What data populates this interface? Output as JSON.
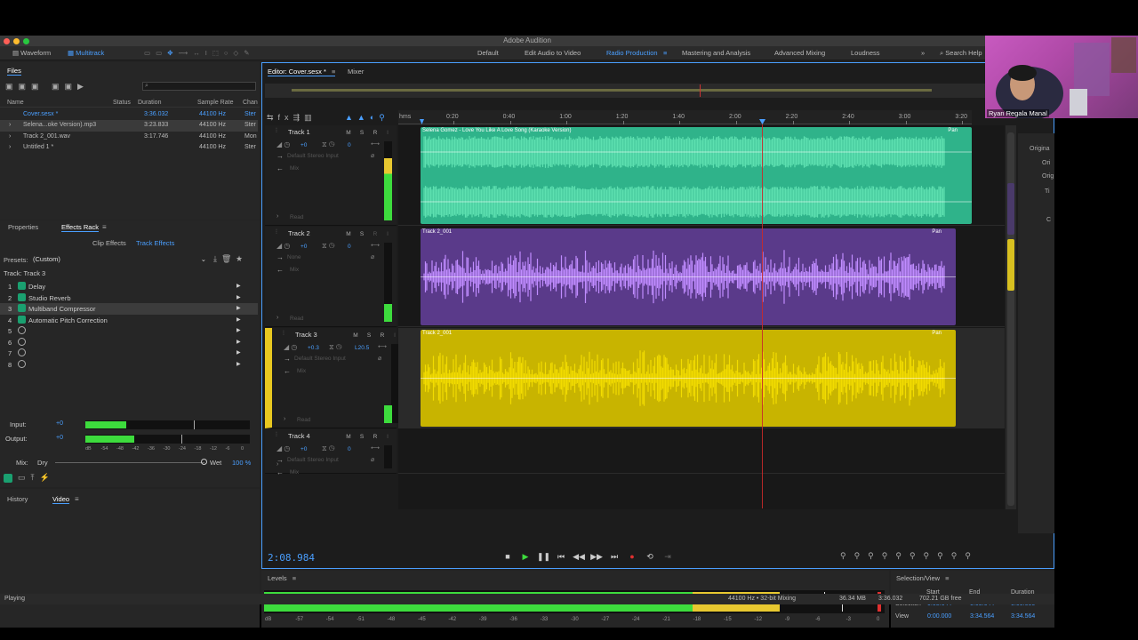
{
  "app": {
    "title": "Adobe Audition"
  },
  "toolbar": {
    "waveform": "Waveform",
    "multitrack": "Multitrack",
    "workspaces": [
      "Default",
      "Edit Audio to Video",
      "Radio Production",
      "Mastering and Analysis",
      "Advanced Mixing",
      "Loudness"
    ],
    "active_workspace": "Radio Production",
    "search_placeholder": "Search Help"
  },
  "files_panel": {
    "title": "Files",
    "columns": [
      "Name",
      "Status",
      "Duration",
      "Sample Rate",
      "Chan"
    ],
    "rows": [
      {
        "name": "Cover.sesx *",
        "status": "",
        "duration": "3:36.032",
        "rate": "44100 Hz",
        "chan": "Ster"
      },
      {
        "name": "Selena...oke Version).mp3",
        "status": "",
        "duration": "3:23.833",
        "rate": "44100 Hz",
        "chan": "Ster"
      },
      {
        "name": "Track 2_001.wav",
        "status": "",
        "duration": "3:17.746",
        "rate": "44100 Hz",
        "chan": "Mon"
      },
      {
        "name": "Untitled 1 *",
        "status": "",
        "duration": "",
        "rate": "44100 Hz",
        "chan": "Ster"
      }
    ]
  },
  "effects_panel": {
    "tabs": [
      "Properties",
      "Effects Rack"
    ],
    "subtabs": [
      "Clip Effects",
      "Track Effects"
    ],
    "presets_label": "Presets:",
    "preset_value": "(Custom)",
    "track_label": "Track: Track 3",
    "effects": [
      {
        "num": "1",
        "name": "Delay"
      },
      {
        "num": "2",
        "name": "Studio Reverb"
      },
      {
        "num": "3",
        "name": "Multiband Compressor"
      },
      {
        "num": "4",
        "name": "Automatic Pitch Correction"
      },
      {
        "num": "5",
        "name": ""
      },
      {
        "num": "6",
        "name": ""
      },
      {
        "num": "7",
        "name": ""
      },
      {
        "num": "8",
        "name": ""
      }
    ],
    "input_label": "Input:",
    "output_label": "Output:",
    "input_gain": "+0",
    "output_gain": "+0",
    "meter_ticks": [
      "dB",
      "-54",
      "-48",
      "-42",
      "-36",
      "-30",
      "-24",
      "-18",
      "-12",
      "-6",
      "0"
    ],
    "mix_label": "Mix:",
    "dry_label": "Dry",
    "wet_label": "Wet",
    "wet_value": "100 %"
  },
  "history_panel": {
    "tabs": [
      "History",
      "Video"
    ]
  },
  "editor": {
    "tab": "Editor: Cover.sesx *",
    "mixer_tab": "Mixer",
    "ruler_unit": "hms",
    "ruler": [
      "0:20",
      "0:40",
      "1:00",
      "1:20",
      "1:40",
      "2:00",
      "2:20",
      "2:40",
      "3:00",
      "3:20"
    ],
    "current_time": "2:08.984",
    "tracks": [
      {
        "name": "Track 1",
        "vol": "+0",
        "pan": "0",
        "input": "Default Stereo Input",
        "output": "Mix",
        "mode": "Read",
        "clip": "Selena Gomez - Love You Like A Love Song (Karaoke Version)",
        "clip_pan": "Pan"
      },
      {
        "name": "Track 2",
        "vol": "+0",
        "pan": "0",
        "input": "None",
        "output": "Mix",
        "mode": "Read",
        "clip": "Track 2_001",
        "clip_pan": "Pan"
      },
      {
        "name": "Track 3",
        "vol": "+0.3",
        "pan": "L20.5",
        "input": "Default Stereo Input",
        "output": "Mix",
        "mode": "Read",
        "clip": "Track 2_001",
        "clip_pan": "Pan"
      },
      {
        "name": "Track 4",
        "vol": "+0",
        "pan": "0",
        "input": "Default Stereo Input",
        "output": "Mix",
        "mode": "",
        "clip": "",
        "clip_pan": ""
      }
    ],
    "clip_colors": [
      "#2fb38a",
      "#5a3a8a",
      "#c8b400"
    ],
    "wave_colors": [
      "#5de0b0",
      "#c08cff",
      "#f2dc00"
    ]
  },
  "levels": {
    "title": "Levels",
    "ticks": [
      "dB",
      "-57",
      "-54",
      "-51",
      "-48",
      "-45",
      "-42",
      "-39",
      "-36",
      "-33",
      "-30",
      "-27",
      "-24",
      "-21",
      "-18",
      "-15",
      "-12",
      "-9",
      "-6",
      "-3",
      "0"
    ]
  },
  "selection_view": {
    "title": "Selection/View",
    "cols": [
      "Start",
      "End",
      "Duration"
    ],
    "selection_label": "Selection",
    "view_label": "View",
    "selection": [
      "0:08.644",
      "0:08.644",
      "0:00.000"
    ],
    "view": [
      "0:00.000",
      "3:34.564",
      "3:34.564"
    ]
  },
  "status": {
    "left": "Playing",
    "rate": "44100 Hz • 32-bit Mixing",
    "mem": "36.34 MB",
    "dur": "3:36.032",
    "free": "702.21 GB free"
  },
  "webcam": {
    "name": "Ryan Regala Manal"
  }
}
